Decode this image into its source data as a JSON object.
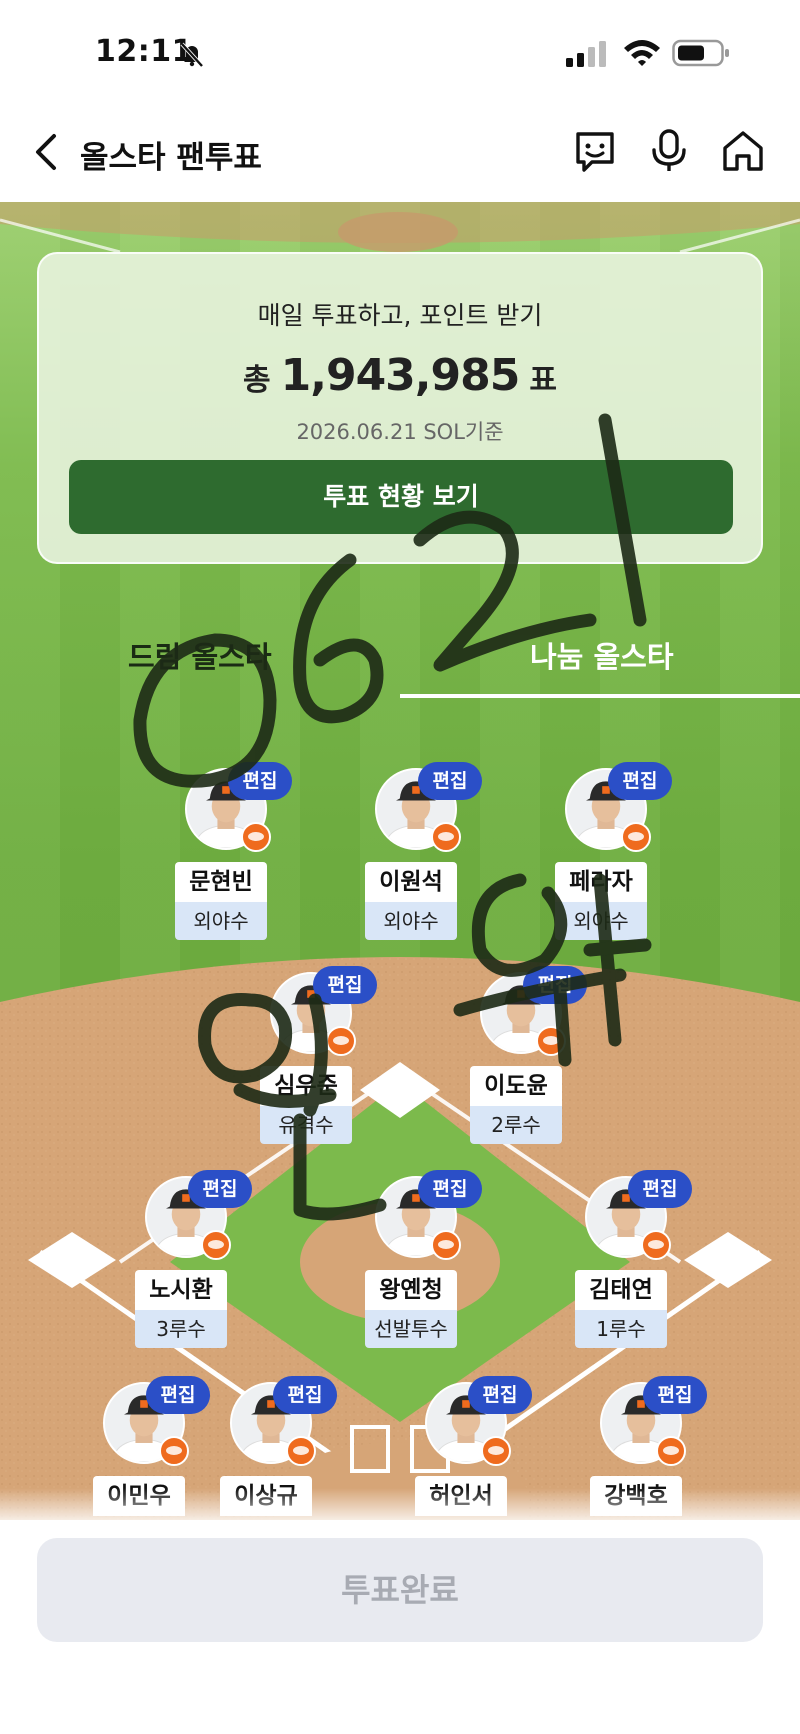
{
  "status_bar": {
    "time": "12:11"
  },
  "header": {
    "title": "올스타 팬투표"
  },
  "card": {
    "subtitle": "매일 투표하고, 포인트 받기",
    "total_prefix": "총",
    "total_votes": "1,943,985",
    "total_suffix": "표",
    "date": "2026.06.21 SOL기준",
    "button_label": "투표 현황 보기"
  },
  "tabs": [
    {
      "label": "드림 올스타",
      "selected": false
    },
    {
      "label": "나눔 올스타",
      "selected": true
    }
  ],
  "edit_label": "편집",
  "players": [
    {
      "name": "문현빈",
      "position": "외야수"
    },
    {
      "name": "이원석",
      "position": "외야수"
    },
    {
      "name": "페라자",
      "position": "외야수"
    },
    {
      "name": "심우준",
      "position": "유격수"
    },
    {
      "name": "이도윤",
      "position": "2루수"
    },
    {
      "name": "노시환",
      "position": "3루수"
    },
    {
      "name": "왕옌청",
      "position": "선발투수"
    },
    {
      "name": "김태연",
      "position": "1루수"
    },
    {
      "name": "이민우",
      "position": ""
    },
    {
      "name": "이상규",
      "position": ""
    },
    {
      "name": "허인서",
      "position": ""
    },
    {
      "name": "강백호",
      "position": ""
    }
  ],
  "vote_button": {
    "label": "투표완료",
    "disabled": true
  },
  "colors": {
    "field_green": "#6fae40",
    "card_button": "#2e6b2f",
    "edit_badge": "#2b4fc7",
    "position_tag": "#d9e6f7",
    "team_orange": "#ef6b1e",
    "disabled_button": "#e8eaf0"
  },
  "icons": [
    "silent-bell-icon",
    "signal-icon",
    "wifi-icon",
    "battery-icon",
    "back-arrow-icon",
    "chatbot-icon",
    "microphone-icon",
    "home-icon"
  ]
}
